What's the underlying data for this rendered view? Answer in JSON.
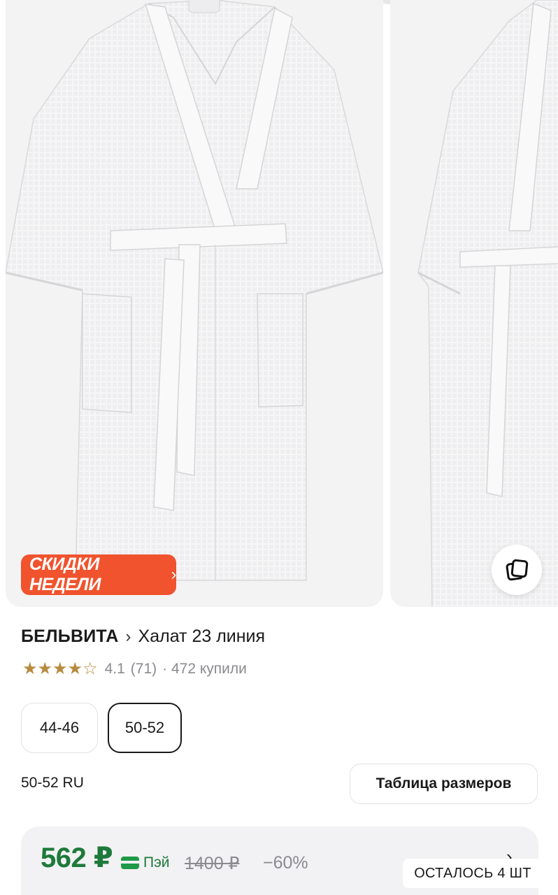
{
  "gallery": {
    "promo_label": "СКИДКИ НЕДЕЛИ",
    "promo_chevron": "›",
    "promo_color": "#f0532d",
    "photo_button_icon": "photos-icon"
  },
  "product": {
    "brand": "БЕЛЬВИТА",
    "separator": "›",
    "name": "Халат 23 линия",
    "rating": "4.1",
    "reviews": "(71)",
    "bought": "· 472 купили",
    "stars_filled": 4,
    "stars_total": 5,
    "star_color": "#b88a3e"
  },
  "sizes": {
    "options": [
      "44-46",
      "50-52"
    ],
    "selected": "50-52",
    "selected_label": "50-52 RU",
    "size_table_button": "Таблица размеров"
  },
  "price": {
    "current": "562 ₽",
    "pay_label": "Пэй",
    "old": "1400 ₽",
    "discount": "−60%",
    "chevron": "›",
    "color": "#1e7a3a"
  },
  "stock": {
    "label": "ОСТАЛОСЬ 4 ШТ"
  }
}
